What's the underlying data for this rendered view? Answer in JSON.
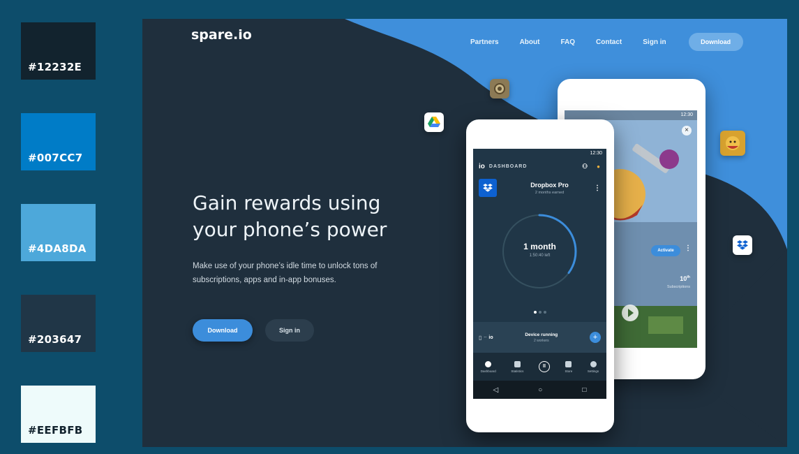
{
  "swatches": [
    {
      "hex": "#12232E",
      "label": "#12232E",
      "text_color": "#ffffff"
    },
    {
      "hex": "#007CC7",
      "label": "#007CC7",
      "text_color": "#ffffff"
    },
    {
      "hex": "#4DA8DA",
      "label": "#4DA8DA",
      "text_color": "#ffffff"
    },
    {
      "hex": "#203647",
      "label": "#203647",
      "text_color": "#ffffff"
    },
    {
      "hex": "#EEFBFB",
      "label": "#EEFBFB",
      "text_color": "#12232E"
    }
  ],
  "site": {
    "logo": "spare.io",
    "nav": [
      "Partners",
      "About",
      "FAQ",
      "Contact",
      "Sign in"
    ],
    "nav_button": "Download",
    "hero_title": "Gain rewards using your phone’s power",
    "hero_subtitle": "Make use of your phone’s idle time to unlock tons of subscriptions, apps and in-app bonuses.",
    "cta_download": "Download",
    "cta_signin": "Sign in"
  },
  "phone_front": {
    "status_time": "12:30",
    "header_logo": "io",
    "header_title": "DASHBOARD",
    "card_title": "Dropbox Pro",
    "card_subtitle": "2 months earned",
    "ring_value": "1 month",
    "ring_sub": "1:50:40 left",
    "ring_progress": 0.35,
    "device_title": "Device running",
    "device_sub": "2 workers",
    "device_logo": "io",
    "tabs": [
      "Dashboard",
      "Statistics",
      "",
      "Store",
      "Settings"
    ]
  },
  "phone_back": {
    "status_time": "12:30",
    "activate_label": "Activate",
    "count_value": "10",
    "count_sup": "th",
    "count_label": "Subscriptions"
  },
  "colors": {
    "bg_dark": "#1f2f3d",
    "wave_blue": "#3f8fdb",
    "accent": "#3c8ddb"
  }
}
